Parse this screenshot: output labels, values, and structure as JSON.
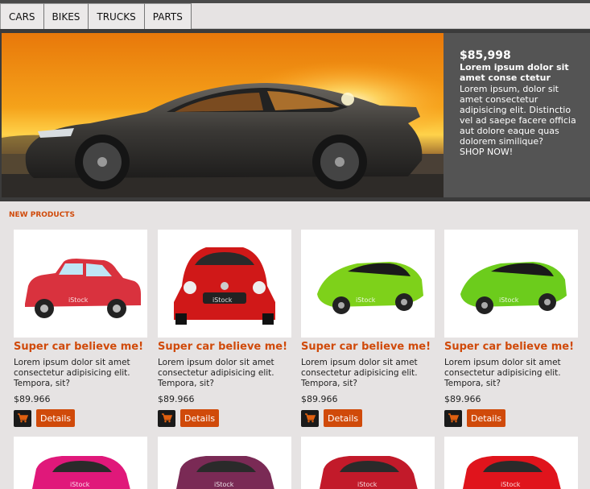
{
  "nav": {
    "items": [
      {
        "label": "CARS"
      },
      {
        "label": "BIKES"
      },
      {
        "label": "TRUCKS"
      },
      {
        "label": "PARTS"
      }
    ]
  },
  "hero": {
    "price": "$85,998",
    "title": "Lorem ipsum dolor sit amet conse ctetur",
    "text": "Lorem ipsum, dolor sit amet consectetur adipisicing elit. Distinctio vel ad saepe facere officia aut dolore eaque quas dolorem similique?",
    "cta": "SHOP NOW!"
  },
  "section": {
    "title": "NEW PRODUCTS"
  },
  "products": [
    {
      "title": "Super car believe me!",
      "desc": "Lorem ipsum dolor sit amet consectetur adipisicing elit. Tempora, sit?",
      "price": "$89.966",
      "details_label": "Details",
      "car_color": "#d9323e"
    },
    {
      "title": "Super car believe me!",
      "desc": "Lorem ipsum dolor sit amet consectetur adipisicing elit. Tempora, sit?",
      "price": "$89.966",
      "details_label": "Details",
      "car_color": "#d01818"
    },
    {
      "title": "Super car believe me!",
      "desc": "Lorem ipsum dolor sit amet consectetur adipisicing elit. Tempora, sit?",
      "price": "$89.966",
      "details_label": "Details",
      "car_color": "#7ed11a"
    },
    {
      "title": "Super car believe me!",
      "desc": "Lorem ipsum dolor sit amet consectetur adipisicing elit. Tempora, sit?",
      "price": "$89.966",
      "details_label": "Details",
      "car_color": "#6ccc1c"
    }
  ],
  "products_row2": [
    {
      "car_color": "#e0187a"
    },
    {
      "car_color": "#7a2a55"
    },
    {
      "car_color": "#c21a2a"
    },
    {
      "car_color": "#e0141c"
    }
  ],
  "watermark": "iStock"
}
